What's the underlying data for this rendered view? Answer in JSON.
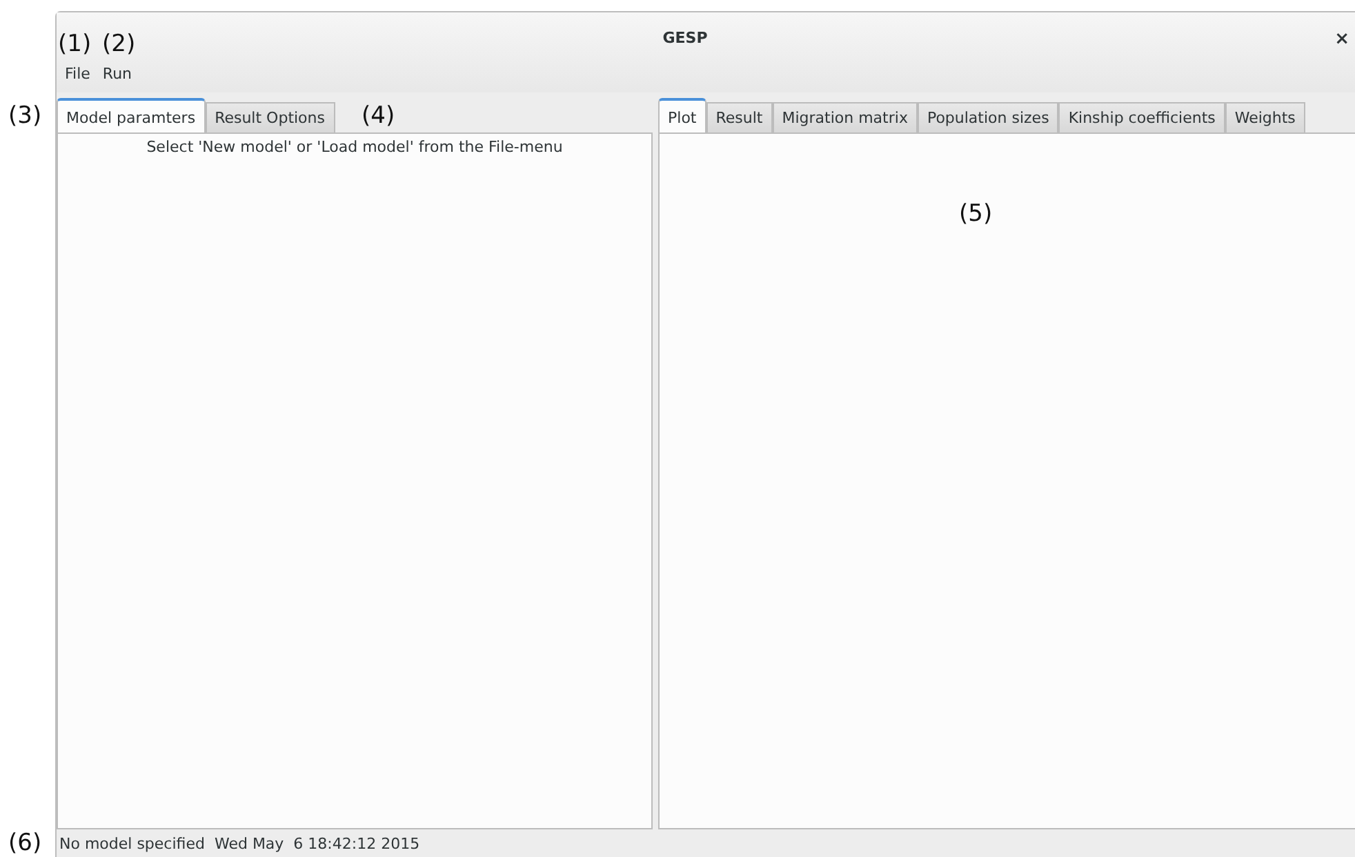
{
  "window": {
    "title": "GESP",
    "close": "×"
  },
  "menu": [
    {
      "label": "File"
    },
    {
      "label": "Run"
    }
  ],
  "left_tabs": [
    {
      "label": "Model paramters",
      "selected": true
    },
    {
      "label": "Result Options",
      "selected": false
    }
  ],
  "left_panel": {
    "message": "Select 'New model' or 'Load model' from the File-menu"
  },
  "right_tabs": [
    {
      "label": "Plot",
      "selected": true
    },
    {
      "label": "Result",
      "selected": false
    },
    {
      "label": "Migration matrix",
      "selected": false
    },
    {
      "label": "Population sizes",
      "selected": false
    },
    {
      "label": "Kinship coefficients",
      "selected": false
    },
    {
      "label": "Weights",
      "selected": false
    }
  ],
  "status_bar": {
    "text": "No model specified  Wed May  6 18:42:12 2015"
  },
  "annotations": [
    {
      "label": "(1)"
    },
    {
      "label": "(2)"
    },
    {
      "label": "(3)"
    },
    {
      "label": "(4)"
    },
    {
      "label": "(5)"
    },
    {
      "label": "(6)"
    }
  ]
}
